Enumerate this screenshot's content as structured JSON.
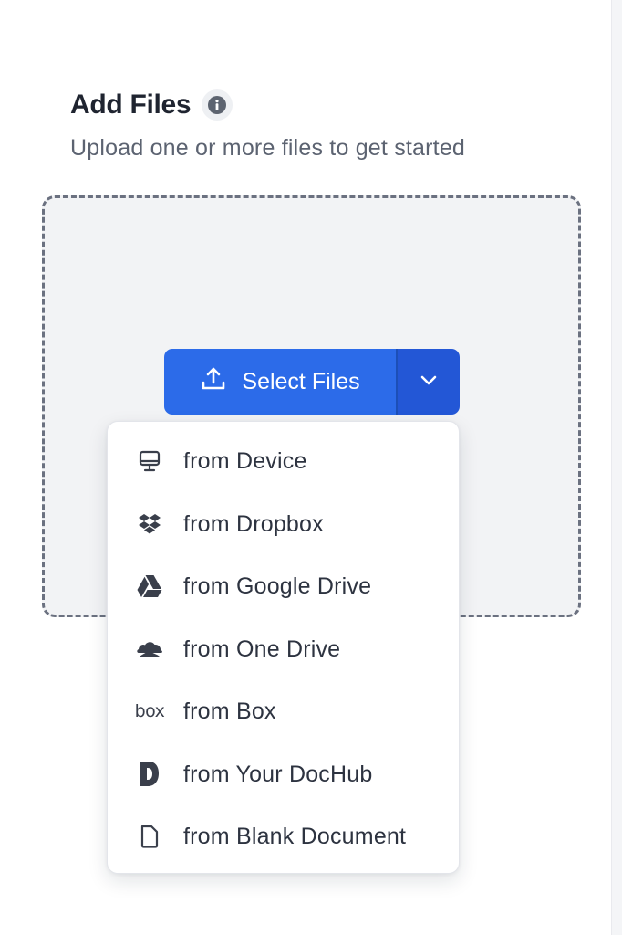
{
  "header": {
    "title": "Add Files",
    "info_icon": "info-circle-icon",
    "subtitle": "Upload one or more files to get started"
  },
  "upload": {
    "button_label": "Select Files",
    "button_icon": "upload-icon",
    "toggle_icon": "chevron-down-icon",
    "accent_color": "#2c6be9"
  },
  "menu": {
    "items": [
      {
        "label": "from Device",
        "icon": "monitor-icon"
      },
      {
        "label": "from Dropbox",
        "icon": "dropbox-icon"
      },
      {
        "label": "from Google Drive",
        "icon": "google-drive-icon"
      },
      {
        "label": "from One Drive",
        "icon": "onedrive-icon"
      },
      {
        "label": "from Box",
        "icon": "box-icon",
        "icon_text": "box"
      },
      {
        "label": "from Your DocHub",
        "icon": "dochub-icon"
      },
      {
        "label": "from Blank Document",
        "icon": "blank-document-icon"
      }
    ]
  }
}
